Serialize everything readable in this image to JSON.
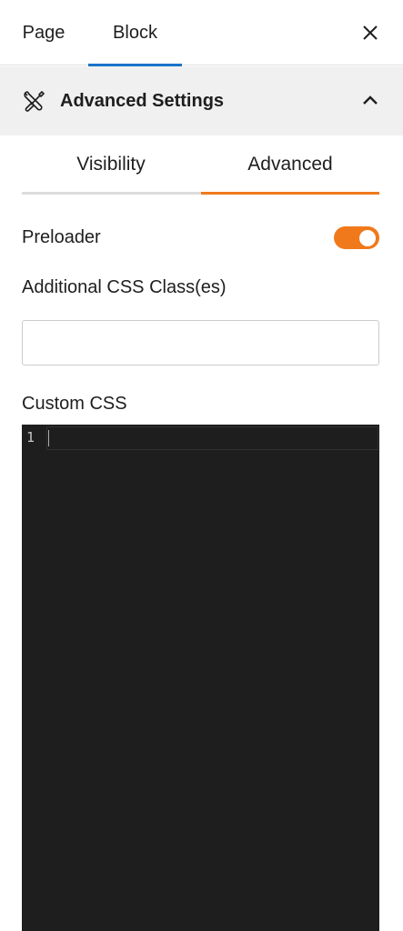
{
  "header": {
    "tabs": [
      {
        "label": "Page",
        "active": false
      },
      {
        "label": "Block",
        "active": true
      }
    ],
    "close_icon": "close-icon",
    "active_color": "#1a73c9"
  },
  "panel": {
    "icon": "tools-icon",
    "title": "Advanced Settings",
    "expanded": true,
    "chevron_icon": "chevron-up-icon"
  },
  "subtabs": {
    "items": [
      {
        "label": "Visibility",
        "active": false
      },
      {
        "label": "Advanced",
        "active": true
      }
    ],
    "accent_color": "#f0791b"
  },
  "preloader": {
    "label": "Preloader",
    "enabled": true,
    "toggle_color": "#f0791b"
  },
  "css_class": {
    "label": "Additional CSS Class(es)",
    "value": "",
    "placeholder": ""
  },
  "custom_css": {
    "label": "Custom CSS",
    "line_numbers": [
      "1"
    ],
    "code": "",
    "background": "#1e1e1e"
  }
}
